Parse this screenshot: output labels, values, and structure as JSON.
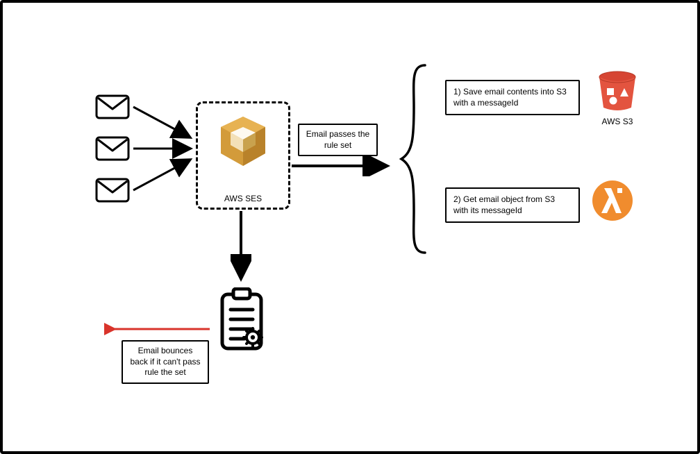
{
  "nodes": {
    "ses": {
      "caption": "AWS SES"
    },
    "s3": {
      "caption": "AWS S3"
    }
  },
  "edges": {
    "pass_ruleset": "Email passes the rule set",
    "bounce_back": "Email bounces back if it can't pass rule the set"
  },
  "steps": {
    "step1": "1) Save email contents into S3 with a messageId",
    "step2": "2) Get email object from S3 with its messageId"
  }
}
